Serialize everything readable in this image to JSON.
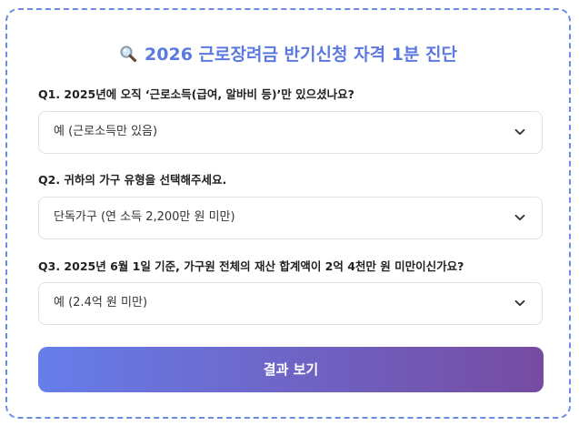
{
  "header": {
    "icon": "magnifier-icon",
    "title": "2026 근로장려금 반기신청 자격 1분 진단"
  },
  "questions": [
    {
      "label": "Q1. 2025년에 오직 ‘근로소득(급여, 알바비 등)’만 있으셨나요?",
      "selected": "예 (근로소득만 있음)"
    },
    {
      "label": "Q2. 귀하의 가구 유형을 선택해주세요.",
      "selected": "단독가구 (연 소득 2,200만 원 미만)"
    },
    {
      "label": "Q3. 2025년 6월 1일 기준, 가구원 전체의 재산 합계액이 2억 4천만 원 미만이신가요?",
      "selected": "예 (2.4억 원 미만)"
    }
  ],
  "submit": {
    "label": "결과 보기"
  },
  "colors": {
    "title": "#5b79e0",
    "border": "#6b8ae6",
    "button_start": "#667eea",
    "button_end": "#764ba2"
  }
}
